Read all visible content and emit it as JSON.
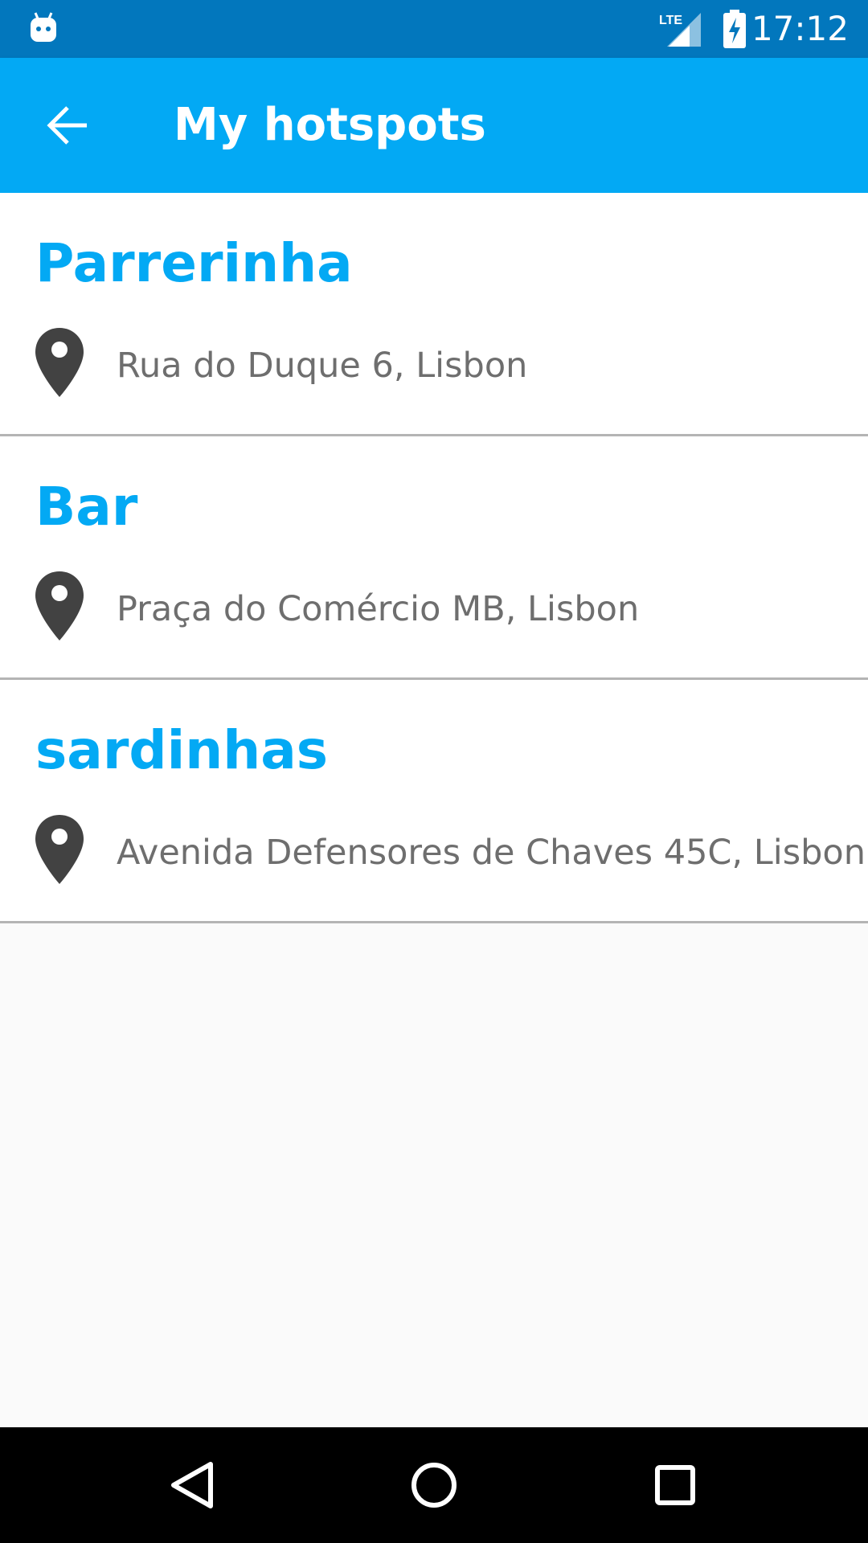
{
  "status_bar": {
    "time": "17:12",
    "network_label": "LTE",
    "icons": [
      "android-robot-icon",
      "lte-signal-icon",
      "battery-charging-icon"
    ]
  },
  "app_bar": {
    "title": "My hotspots",
    "back_icon": "arrow-back-icon"
  },
  "hotspots": [
    {
      "name": "Parrerinha",
      "address": "Rua do Duque 6, Lisbon"
    },
    {
      "name": "Bar",
      "address": "Praça do Comércio MB, Lisbon"
    },
    {
      "name": "sardinhas",
      "address": "Avenida Defensores de Chaves 45C, Lisbon"
    }
  ],
  "nav_bar": {
    "icons": [
      "back-triangle-icon",
      "home-circle-icon",
      "recents-square-icon"
    ]
  },
  "colors": {
    "status_bar": "#0277bd",
    "app_bar": "#03a9f4",
    "accent_text": "#03a9f4",
    "address_text": "#6e6e6e",
    "pin": "#424242",
    "background": "#fafafa"
  }
}
